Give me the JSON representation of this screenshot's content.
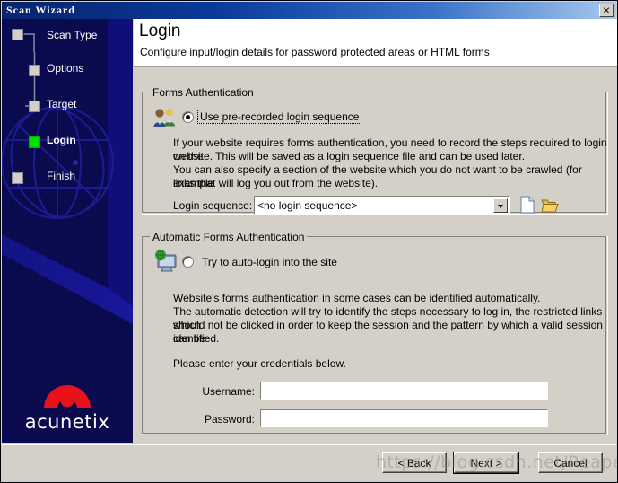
{
  "window": {
    "title": "Scan Wizard",
    "close_label": "X"
  },
  "sidebar": {
    "steps": [
      {
        "label": "Scan Type",
        "active": false
      },
      {
        "label": "Options",
        "active": false
      },
      {
        "label": "Target",
        "active": false
      },
      {
        "label": "Login",
        "active": true
      },
      {
        "label": "Finish",
        "active": false
      }
    ],
    "logo_text": "acunetix",
    "logo_color": "#e8121a",
    "background_color": "#0a0a4e"
  },
  "header": {
    "title": "Login",
    "subtitle": "Configure input/login details for password protected areas or HTML forms"
  },
  "forms_auth": {
    "group_title": "Forms Authentication",
    "radio_label": "Use pre-recorded login sequence",
    "radio_selected": true,
    "description_line1": "If your website requires forms authentication, you need to record the steps required to login on the",
    "description_line2": "website. This will be saved as a login sequence file and can be used later.",
    "description_line3": "You can also specify a section of the website which you do not want to be crawled (for example",
    "description_line4": "links that will log you out from the website).",
    "sequence_label": "Login sequence:",
    "sequence_value": "<no login sequence>",
    "new_icon": "new-file-icon",
    "open_icon": "open-folder-icon"
  },
  "auto_auth": {
    "group_title": "Automatic Forms Authentication",
    "radio_label": "Try to auto-login into the site",
    "radio_selected": false,
    "description_line1": "Website's forms authentication in some cases can be identified automatically.",
    "description_line2": "The automatic detection will try to identify the steps necessary to log in, the restricted links which",
    "description_line3": "should not be clicked in order to keep the session and the pattern by which a valid session can be",
    "description_line4": "identified.",
    "credentials_prompt": "Please enter your credentials below.",
    "username_label": "Username:",
    "username_value": "",
    "password_label": "Password:",
    "password_value": ""
  },
  "footer": {
    "back_label": "< Back",
    "next_label": "Next >",
    "cancel_label": "Cancel",
    "default_button": "Next >"
  },
  "watermark": {
    "text": "https://blog.csdn.net/ReaperBC"
  }
}
